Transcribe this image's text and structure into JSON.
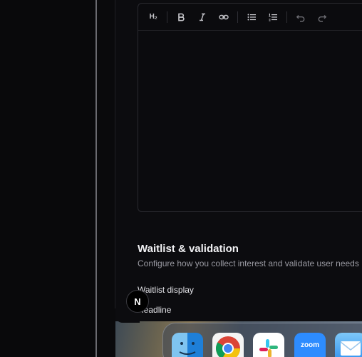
{
  "editor": {
    "toolbar": {
      "heading_label": "H₂",
      "icons": [
        "heading-icon",
        "bold-icon",
        "italic-icon",
        "link-icon",
        "bullet-list-icon",
        "numbered-list-icon",
        "undo-icon",
        "redo-icon"
      ]
    }
  },
  "section": {
    "title": "Waitlist & validation",
    "description": "Configure how you collect interest and validate user needs",
    "fields": {
      "waitlist_display": "Waitlist display",
      "headline": "Headline"
    }
  },
  "badge": {
    "letter": "N"
  },
  "dock": {
    "apps": [
      "Finder",
      "Google Chrome",
      "Slack",
      "Zoom",
      "Mail"
    ],
    "zoom_label": "zoom"
  },
  "colors": {
    "background": "#0b0b0e",
    "text_primary": "#f2f2f4",
    "text_secondary": "#9a9aa2",
    "border": "#2a2a30"
  }
}
